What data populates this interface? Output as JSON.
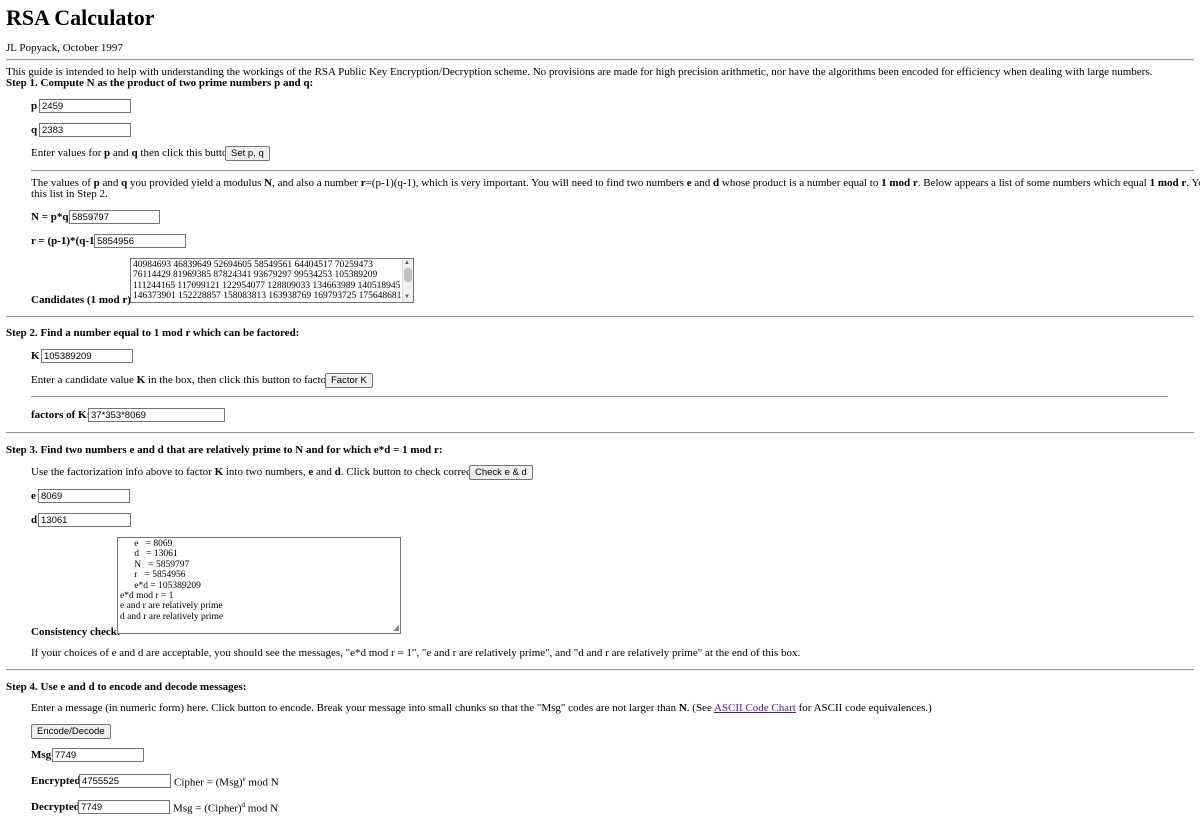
{
  "page": {
    "title": "RSA Calculator",
    "author": "JL Popyack, October 1997",
    "intro": "This guide is intended to help with understanding the workings of the RSA Public Key Encryption/Decryption scheme. No provisions are made for high precision arithmetic, nor have the algorithms been encoded for efficiency when dealing with large numbers."
  },
  "step1": {
    "heading": "Step 1. Compute N as the product of two prime numbers p and q:",
    "p_label": "p",
    "p_value": "2459",
    "q_label": "q",
    "q_value": "2383",
    "instruction_pre": "Enter values for ",
    "instruction_p": "p",
    "instruction_and": " and ",
    "instruction_q": "q",
    "instruction_post": " then click this button:",
    "button": "Set p, q",
    "explain_line1_a": "The values of ",
    "explain_p": "p",
    "explain_and": " and ",
    "explain_q": "q",
    "explain_line1_b": " you provided yield a modulus ",
    "explain_N": "N",
    "explain_line1_c": ", and also a number ",
    "explain_r": "r",
    "explain_line1_d": "=(p-1)(q-1), which is very important. You will need to find two numbers ",
    "explain_e": "e",
    "explain_and2": " and ",
    "explain_d": "d",
    "explain_line1_e": " whose product is a number equal to ",
    "explain_1modr": "1 mod r",
    "explain_line1_f": ". Below appears a list of some numbers which equal ",
    "explain_1modr2": "1 mod r",
    "explain_line1_g": ". You will use",
    "explain_line2": "this list in Step 2.",
    "N_label": "N = p*q",
    "N_value": "5859797",
    "r_label": "r = (p-1)*(q-1)",
    "r_value": "5854956",
    "candidates_label": "Candidates (1 mod r):",
    "candidates_lines": [
      "40984693 46839649 52694605 58549561 64404517 70259473",
      "76114429 81969385 87824341 93679297 99534253 105389209",
      "111244165 117099121 122954077 128809033 134663989 140518945",
      "146373901 152228857 158083813 163938769 169793725 175648681"
    ]
  },
  "step2": {
    "heading": "Step 2. Find a number equal to 1 mod r which can be factored:",
    "K_label": "K",
    "K_value": "105389209",
    "instruction_pre": "Enter a candidate value ",
    "instruction_K": "K",
    "instruction_post": " in the box, then click this button to factor it:",
    "button": "Factor K",
    "factors_label": "factors of K:",
    "factors_value": "37*353*8069"
  },
  "step3": {
    "heading": "Step 3. Find two numbers e and d that are relatively prime to N and for which e*d = 1 mod r:",
    "instruction_a": "Use the factorization info above to factor ",
    "instruction_K": "K",
    "instruction_b": " into two numbers, ",
    "instruction_e": "e",
    "instruction_and": " and ",
    "instruction_d": "d",
    "instruction_c": ". Click button to check correctness:",
    "button": "Check e & d",
    "e_label": "e",
    "e_value": "8069",
    "d_label": "d",
    "d_value": "13061",
    "check_lines": [
      "      e   = 8069",
      "      d   = 13061",
      "      N   = 5859797",
      "      r   = 5854956",
      "      e*d = 105389209",
      "e*d mod r = 1",
      "e and r are relatively prime",
      "d and r are relatively prime"
    ],
    "consistency_label": "Consistency check:",
    "note": "If your choices of e and d are acceptable, you should see the messages, \"e*d mod r = 1\", \"e and r are relatively prime\", and \"d and r are relatively prime\" at the end of this box."
  },
  "step4": {
    "heading": "Step 4. Use e and d to encode and decode messages:",
    "instruction_a": "Enter a message (in numeric form) here. Click button to encode. Break your message into small chunks so that the \"Msg\" codes are not larger than ",
    "instruction_N": "N",
    "instruction_b": ". (See ",
    "link": "ASCII Code Chart",
    "instruction_c": " for ASCII code equivalences.)",
    "button": "Encode/Decode",
    "msg_label": "Msg",
    "msg_value": "7749",
    "enc_label": "Encrypted",
    "enc_value": "4755525",
    "enc_formula_a": "Cipher = (Msg)",
    "enc_formula_sup": "e",
    "enc_formula_b": " mod N",
    "dec_label": "Decrypted",
    "dec_value": "7749",
    "dec_formula_a": "Msg = (Cipher)",
    "dec_formula_sup": "d",
    "dec_formula_b": " mod N"
  }
}
